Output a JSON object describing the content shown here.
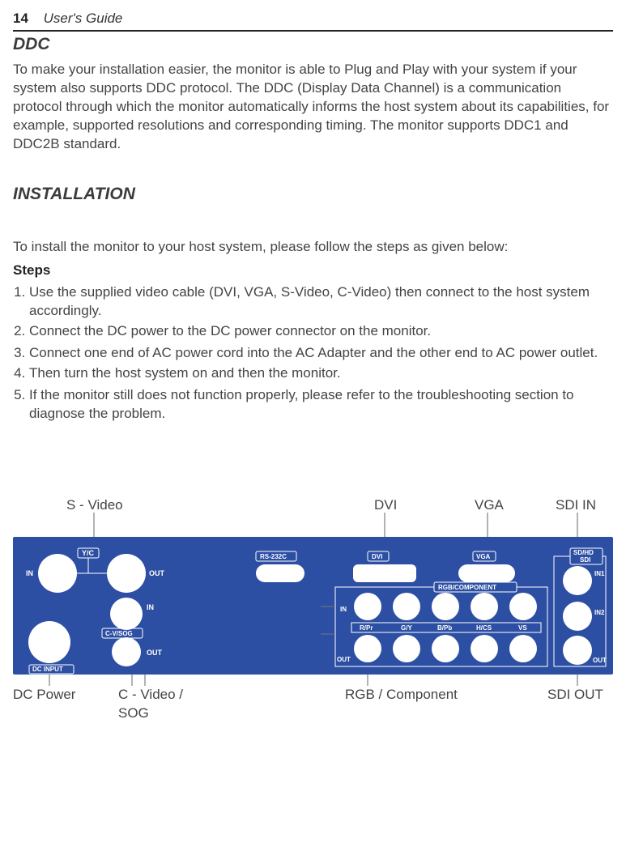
{
  "header": {
    "page_number": "14",
    "guide": "User's Guide"
  },
  "ddc": {
    "title": "DDC",
    "body": "To make your installation easier, the monitor is able to Plug and Play with your system if your system also supports DDC protocol. The DDC (Display Data Channel) is a communication protocol through which the monitor automatically informs the host system  about its capabilities, for example, supported resolutions and corresponding timing. The monitor supports DDC1 and DDC2B standard."
  },
  "installation": {
    "title": "INSTALLATION",
    "intro": "To install the monitor to your host system, please follow the steps as given below:",
    "steps_label": "Steps",
    "steps": [
      "Use the supplied video cable (DVI, VGA, S-Video, C-Video) then connect to the host system accordingly.",
      "Connect the DC power to the DC power connector on the monitor.",
      "Connect one end of AC power cord into the AC Adapter and the other end to AC power outlet.",
      "Then turn the host system on and then the monitor.",
      "If the monitor still does not function properly, please refer to the troubleshooting section to diagnose the problem."
    ]
  },
  "diagram": {
    "top_labels": {
      "svideo": "S - Video",
      "dvi": "DVI",
      "vga": "VGA",
      "sdi_in": "SDI IN"
    },
    "side_labels": {
      "in": "IN",
      "out": "OUT"
    },
    "panel": {
      "yc": "Y/C",
      "in": "IN",
      "out": "OUT",
      "cv_sog": "C-V/SOG",
      "dc_input": "DC INPUT",
      "rs232c": "RS-232C",
      "dvi": "DVI",
      "vga": "VGA",
      "rgb_component": "RGB/COMPONENT",
      "rpr": "R/Pr",
      "gy": "G/Y",
      "bpb": "B/Pb",
      "hcs": "H/CS",
      "vs": "VS",
      "sdhd_sdi": "SD/HD SDI",
      "in1": "IN1",
      "in2": "IN2"
    },
    "bottom_labels": {
      "dc_power": "DC Power",
      "c_video_sog": "C - Video / SOG",
      "rgb_component": "RGB / Component",
      "sdi_out": "SDI OUT"
    }
  }
}
